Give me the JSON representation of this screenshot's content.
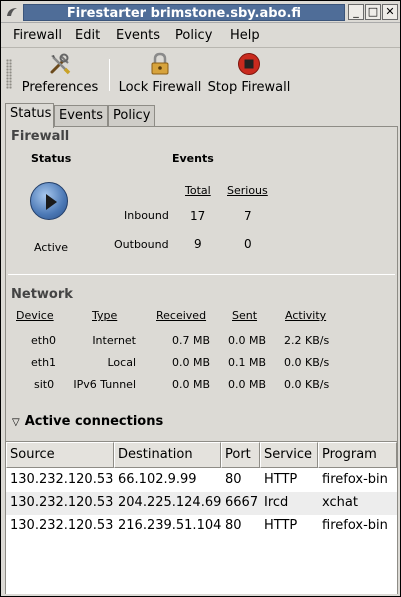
{
  "window": {
    "title": "Firestarter brimstone.sby.abo.fi",
    "buttons": {
      "minimize": "_",
      "maximize": "□",
      "close": "✕"
    }
  },
  "menubar": {
    "items": [
      {
        "label": "Firewall",
        "underline": "F"
      },
      {
        "label": "Edit"
      },
      {
        "label": "Events"
      },
      {
        "label": "Policy"
      },
      {
        "label": "Help"
      }
    ]
  },
  "toolbar": {
    "preferences": {
      "label": "Preferences",
      "icon": "tools-icon"
    },
    "lock": {
      "label": "Lock Firewall",
      "icon": "padlock-icon"
    },
    "stop": {
      "label": "Stop Firewall",
      "icon": "stop-icon"
    }
  },
  "tabs": [
    {
      "label": "Status",
      "active": true
    },
    {
      "label": "Events",
      "active": false
    },
    {
      "label": "Policy",
      "active": false
    }
  ],
  "firewall": {
    "section_title": "Firewall",
    "status_header": "Status",
    "status_value": "Active",
    "events_header": "Events",
    "total_header": "Total",
    "serious_header": "Serious",
    "inbound_label": "Inbound",
    "inbound_total": "17",
    "inbound_serious": "7",
    "outbound_label": "Outbound",
    "outbound_total": "9",
    "outbound_serious": "0"
  },
  "network": {
    "section_title": "Network",
    "headers": {
      "device": "Device",
      "type": "Type",
      "received": "Received",
      "sent": "Sent",
      "activity": "Activity"
    },
    "rows": [
      {
        "device": "eth0",
        "type": "Internet",
        "received": "0.7 MB",
        "sent": "0.0 MB",
        "activity": "2.2 KB/s"
      },
      {
        "device": "eth1",
        "type": "Local",
        "received": "0.0 MB",
        "sent": "0.1 MB",
        "activity": "0.0 KB/s"
      },
      {
        "device": "sit0",
        "type": "IPv6 Tunnel",
        "received": "0.0 MB",
        "sent": "0.0 MB",
        "activity": "0.0 KB/s"
      }
    ]
  },
  "connections": {
    "title": "Active connections",
    "headers": {
      "source": "Source",
      "destination": "Destination",
      "port": "Port",
      "service": "Service",
      "program": "Program"
    },
    "rows": [
      {
        "source": "130.232.120.53",
        "destination": "66.102.9.99",
        "port": "80",
        "service": "HTTP",
        "program": "firefox-bin"
      },
      {
        "source": "130.232.120.53",
        "destination": "204.225.124.69",
        "port": "6667",
        "service": "Ircd",
        "program": "xchat"
      },
      {
        "source": "130.232.120.53",
        "destination": "216.239.51.104",
        "port": "80",
        "service": "HTTP",
        "program": "firefox-bin"
      }
    ]
  }
}
